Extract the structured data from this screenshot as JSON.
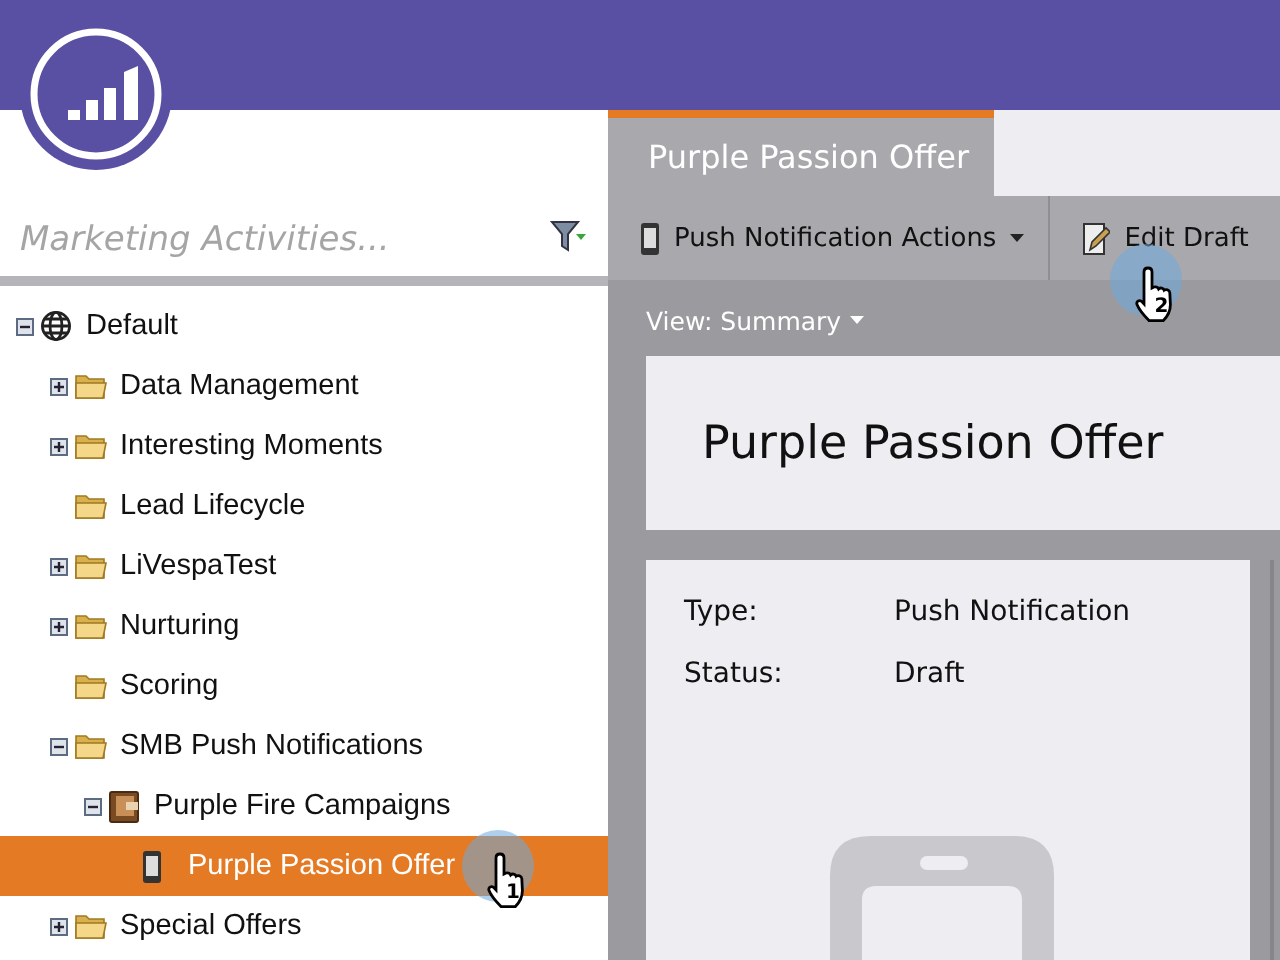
{
  "sidebar": {
    "search": {
      "placeholder": "Marketing Activities..."
    },
    "tree": [
      {
        "label": "Default",
        "kind": "root",
        "expanded": true,
        "selected": false,
        "children": [
          {
            "label": "Data Management",
            "kind": "folder",
            "expanded": false,
            "selected": false
          },
          {
            "label": "Interesting Moments",
            "kind": "folder",
            "expanded": false,
            "selected": false
          },
          {
            "label": "Lead Lifecycle",
            "kind": "folder",
            "selected": false
          },
          {
            "label": "LiVespaTest",
            "kind": "folder",
            "expanded": false,
            "selected": false
          },
          {
            "label": "Nurturing",
            "kind": "folder",
            "expanded": false,
            "selected": false
          },
          {
            "label": "Scoring",
            "kind": "folder",
            "selected": false
          },
          {
            "label": "SMB Push Notifications",
            "kind": "folder",
            "expanded": true,
            "selected": false,
            "children": [
              {
                "label": "Purple Fire Campaigns",
                "kind": "program",
                "expanded": true,
                "selected": false,
                "children": [
                  {
                    "label": "Purple Passion Offer",
                    "kind": "push",
                    "selected": true,
                    "cursor": "1"
                  }
                ]
              }
            ]
          },
          {
            "label": "Special Offers",
            "kind": "folder",
            "expanded": false,
            "selected": false
          }
        ]
      }
    ]
  },
  "tabs": [
    {
      "label": "Purple Passion Offer",
      "selected": true
    }
  ],
  "toolbar": [
    {
      "label": "Push Notification Actions",
      "kind": "menu"
    },
    {
      "label": "Edit Draft",
      "kind": "edit",
      "cursor": "2"
    }
  ],
  "view": {
    "label": "View: Summary"
  },
  "title": "Purple Passion Offer",
  "details": [
    {
      "label": "Type:",
      "value": "Push Notification"
    },
    {
      "label": "Status:",
      "value": "Draft"
    }
  ]
}
